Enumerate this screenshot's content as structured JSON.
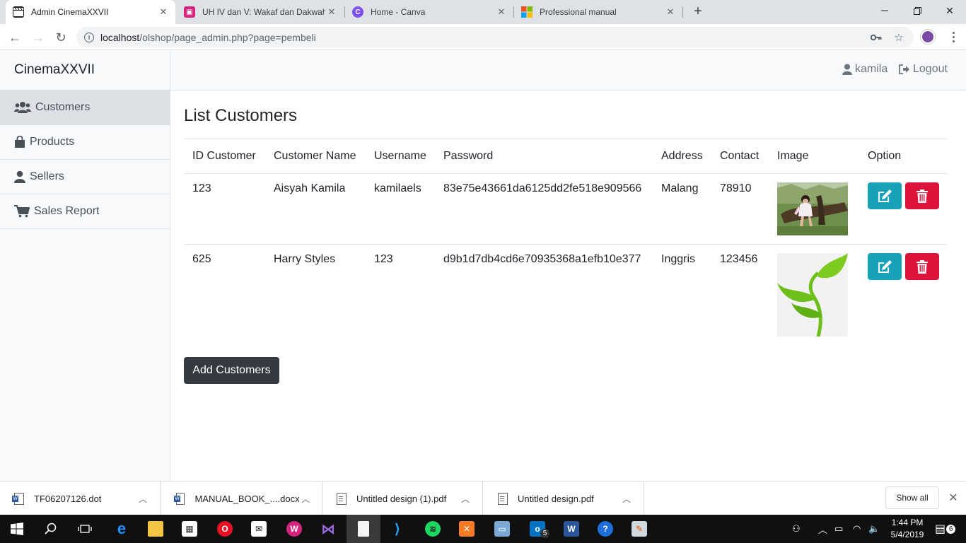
{
  "browser": {
    "tabs": [
      {
        "title": "Admin CinemaXXVII",
        "active": true
      },
      {
        "title": "UH IV dan V: Wakaf dan Dakwah",
        "active": false
      },
      {
        "title": "Home - Canva",
        "active": false
      },
      {
        "title": "Professional manual",
        "active": false
      }
    ],
    "url_host": "localhost",
    "url_path": "/olshop/page_admin.php?page=pembeli"
  },
  "sidebar": {
    "brand": "CinemaXXVII",
    "items": [
      {
        "label": "Customers",
        "icon": "users-icon",
        "active": true
      },
      {
        "label": "Products",
        "icon": "shopping-bag-icon",
        "active": false
      },
      {
        "label": "Sellers",
        "icon": "user-icon",
        "active": false
      },
      {
        "label": "Sales Report",
        "icon": "cart-icon",
        "active": false
      }
    ]
  },
  "topbar": {
    "username": "kamila",
    "logout_label": "Logout"
  },
  "main": {
    "title": "List Customers",
    "columns": [
      "ID Customer",
      "Customer Name",
      "Username",
      "Password",
      "Address",
      "Contact",
      "Image",
      "Option"
    ],
    "rows": [
      {
        "id": "123",
        "name": "Aisyah Kamila",
        "username": "kamilaels",
        "password": "83e75e43661da6125dd2fe518e909566",
        "address": "Malang",
        "contact": "78910",
        "image": "child-photo"
      },
      {
        "id": "625",
        "name": "Harry Styles",
        "username": "123",
        "password": "d9b1d7db4cd6e70935368a1efb10e377",
        "address": "Inggris",
        "contact": "123456",
        "image": "plant-sprout-image"
      }
    ],
    "add_button": "Add Customers"
  },
  "downloads": {
    "items": [
      {
        "name": "TF06207126.dot",
        "type": "word"
      },
      {
        "name": "MANUAL_BOOK_....docx",
        "type": "word"
      },
      {
        "name": "Untitled design (1).pdf",
        "type": "pdf"
      },
      {
        "name": "Untitled design.pdf",
        "type": "pdf"
      }
    ],
    "show_all": "Show all"
  },
  "taskbar": {
    "time": "1:44 PM",
    "date": "5/4/2019",
    "notification_count": "6",
    "mail_badge": "5"
  },
  "colors": {
    "edit_button": "#17a2b8",
    "delete_button": "#dc143c",
    "add_button": "#343a40"
  }
}
